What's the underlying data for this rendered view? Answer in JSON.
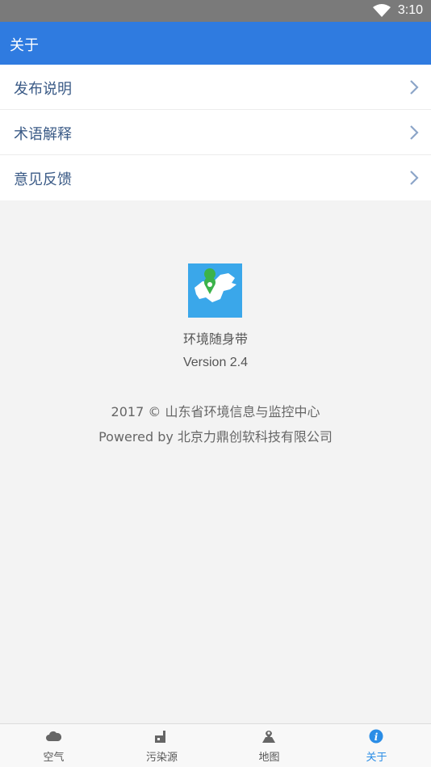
{
  "status_bar": {
    "time": "3:10"
  },
  "app_bar": {
    "title": "关于"
  },
  "menu": {
    "items": [
      {
        "label": "发布说明"
      },
      {
        "label": "术语解释"
      },
      {
        "label": "意见反馈"
      }
    ]
  },
  "about": {
    "app_name": "环境随身带",
    "version": "Version 2.4",
    "copyright": "2017 © 山东省环境信息与监控中心",
    "powered_by": "Powered by 北京力鼎创软科技有限公司"
  },
  "bottom_nav": {
    "items": [
      {
        "label": "空气",
        "icon": "cloud-icon"
      },
      {
        "label": "污染源",
        "icon": "factory-icon"
      },
      {
        "label": "地图",
        "icon": "map-pin-icon"
      },
      {
        "label": "关于",
        "icon": "info-icon",
        "active": true
      }
    ]
  },
  "colors": {
    "primary": "#2f7be0",
    "status_bar": "#7a7a7a",
    "menu_text": "#3a5a86",
    "active_tab": "#2a8de6",
    "logo_bg": "#3aa7ea"
  }
}
